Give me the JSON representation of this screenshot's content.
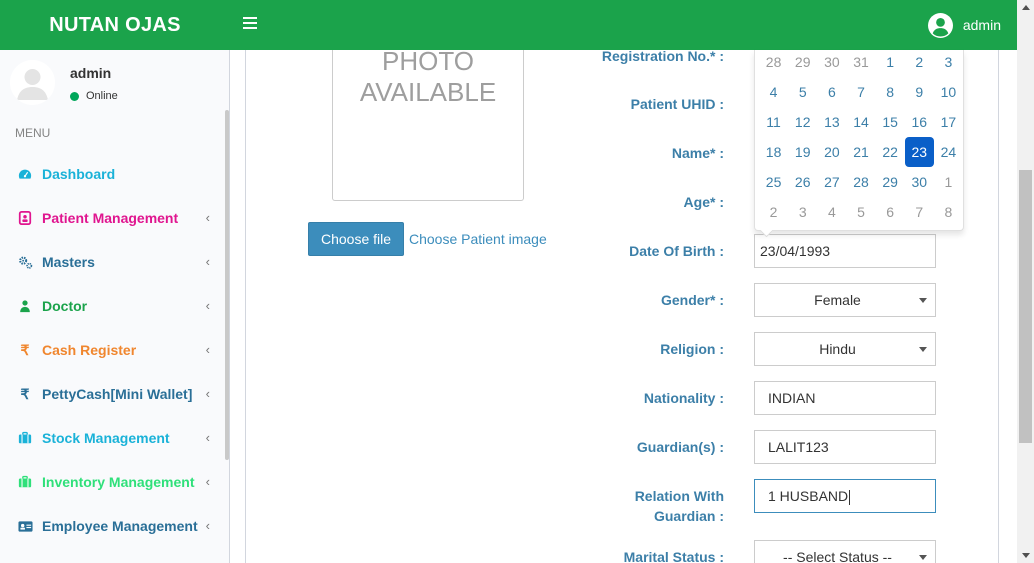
{
  "header": {
    "brand": "NUTAN OJAS",
    "menu_icon": "hamburger-icon",
    "user_icon": "user-circle-icon",
    "user_name": "admin",
    "color": "#1ba34b"
  },
  "sidebar": {
    "user": {
      "name": "admin",
      "status": "Online",
      "status_color": "#00a65a"
    },
    "menu_header": "MENU",
    "items": [
      {
        "label": "Dashboard",
        "icon": "dashboard-icon",
        "color": "#1ab2d8",
        "has_submenu": false
      },
      {
        "label": "Patient Management",
        "icon": "patient-icon",
        "color": "#e0158f",
        "has_submenu": true
      },
      {
        "label": "Masters",
        "icon": "gears-icon",
        "color": "#2a6f97",
        "has_submenu": true
      },
      {
        "label": "Doctor",
        "icon": "doctor-icon",
        "color": "#1ba34b",
        "has_submenu": true
      },
      {
        "label": "Cash Register",
        "icon": "rupee-icon",
        "color": "#f0862e",
        "has_submenu": true
      },
      {
        "label": "PettyCash[Mini Wallet]",
        "icon": "rupee-icon",
        "color": "#2a6f97",
        "has_submenu": true
      },
      {
        "label": "Stock Management",
        "icon": "briefcase-icon",
        "color": "#1ab2d8",
        "has_submenu": true
      },
      {
        "label": "Inventory Management",
        "icon": "briefcase-icon",
        "color": "#2fe07a",
        "has_submenu": true
      },
      {
        "label": "Employee Management",
        "icon": "id-card-icon",
        "color": "#2a6f97",
        "has_submenu": true
      }
    ]
  },
  "photo": {
    "line1": "PHOTO",
    "line2": "AVAILABLE",
    "choose_button": "Choose file",
    "choose_text": "Choose Patient image"
  },
  "form": {
    "registration_label": "Registration No.* :",
    "uhid_label": "Patient UHID :",
    "name_label": "Name* :",
    "age_label": "Age* :",
    "dob_label": "Date Of Birth :",
    "dob_value": "23/04/1993",
    "gender_label": "Gender* :",
    "gender_value": "Female",
    "religion_label": "Religion :",
    "religion_value": "Hindu",
    "nationality_label": "Nationality :",
    "nationality_value": "INDIAN",
    "guardian_label": "Guardian(s) :",
    "guardian_value": "LALIT123",
    "relation_label_1": "Relation With",
    "relation_label_2": "Guardian :",
    "relation_value": "1 HUSBAND",
    "marital_label": "Marital Status :",
    "marital_value": "-- Select Status --"
  },
  "datepicker": {
    "weeks": [
      [
        {
          "d": "28",
          "old": true
        },
        {
          "d": "29",
          "old": true
        },
        {
          "d": "30",
          "old": true
        },
        {
          "d": "31",
          "old": true
        },
        {
          "d": "1"
        },
        {
          "d": "2"
        },
        {
          "d": "3"
        }
      ],
      [
        {
          "d": "4"
        },
        {
          "d": "5"
        },
        {
          "d": "6"
        },
        {
          "d": "7"
        },
        {
          "d": "8"
        },
        {
          "d": "9"
        },
        {
          "d": "10"
        }
      ],
      [
        {
          "d": "11"
        },
        {
          "d": "12"
        },
        {
          "d": "13"
        },
        {
          "d": "14"
        },
        {
          "d": "15"
        },
        {
          "d": "16"
        },
        {
          "d": "17"
        }
      ],
      [
        {
          "d": "18"
        },
        {
          "d": "19"
        },
        {
          "d": "20"
        },
        {
          "d": "21"
        },
        {
          "d": "22"
        },
        {
          "d": "23",
          "active": true
        },
        {
          "d": "24"
        }
      ],
      [
        {
          "d": "25"
        },
        {
          "d": "26"
        },
        {
          "d": "27"
        },
        {
          "d": "28"
        },
        {
          "d": "29"
        },
        {
          "d": "30"
        },
        {
          "d": "1",
          "old": true
        }
      ],
      [
        {
          "d": "2",
          "old": true
        },
        {
          "d": "3",
          "old": true
        },
        {
          "d": "4",
          "old": true
        },
        {
          "d": "5",
          "old": true
        },
        {
          "d": "6",
          "old": true
        },
        {
          "d": "7",
          "old": true
        },
        {
          "d": "8",
          "old": true
        }
      ]
    ],
    "selected_color": "#0a5fc8"
  }
}
